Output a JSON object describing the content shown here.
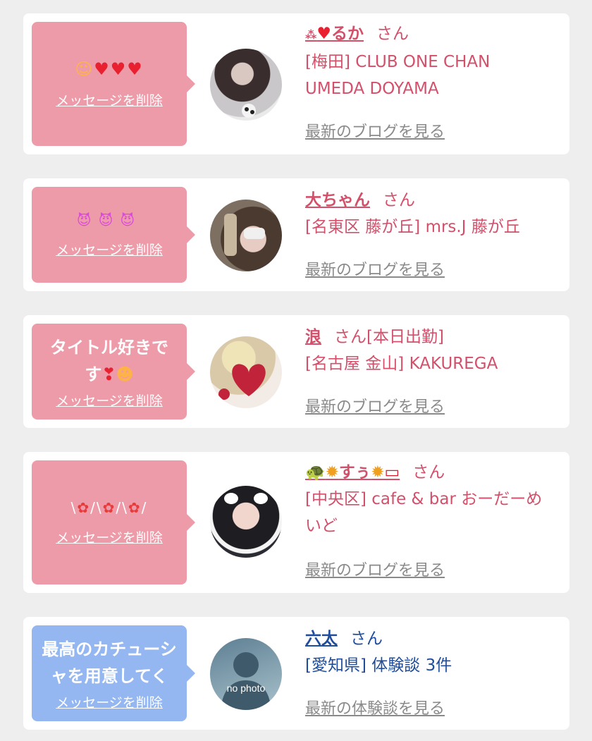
{
  "delete_label": "メッセージを削除",
  "honorific": "さん",
  "items": [
    {
      "message_icons": [
        "smiley-face-icon",
        "heart-icon",
        "heart-icon",
        "heart-icon"
      ],
      "user_name": "るか",
      "name_prefix_icons": [
        "sparkle-icon",
        "heart-icon"
      ],
      "status": "",
      "shop_line1": "[梅田] CLUB ONE CHAN",
      "shop_line2": "UMEDA DOYAMA",
      "link": "最新のブログを見る",
      "bubble_color": "#ee9ba9"
    },
    {
      "message_icons": [
        "smiling-devil-icon",
        "smiling-devil-icon",
        "smiling-devil-icon"
      ],
      "user_name": "大ちゃん",
      "status": "",
      "shop_line1": "[名東区 藤が丘] mrs.J 藤が丘",
      "link": "最新のブログを見る",
      "bubble_color": "#ee9ba9"
    },
    {
      "message_line1": "タイトル好きで",
      "message_line2": "す",
      "message_icons": [
        "heart-exclamation-icon",
        "grinning-squint-face-icon"
      ],
      "user_name": "浪",
      "status": "[本日出勤]",
      "shop_line1": "[名古屋 金山] KAKUREGA",
      "link": "最新のブログを見る",
      "bubble_color": "#ee9ba9"
    },
    {
      "message_icons": [
        "tulip-icon",
        "tulip-icon",
        "tulip-icon"
      ],
      "message_deco": "\\ ✿ /\\ ✿ /\\ ✿ /",
      "user_name": "すぅ",
      "name_icons": [
        "turtle-icon",
        "sunflower-icon",
        "sunflower-icon",
        "mouth-icon"
      ],
      "status": "",
      "shop_line1": "[中央区] cafe & bar おーだーめ",
      "shop_line2": "いど",
      "link": "最新のブログを見る",
      "bubble_color": "#ee9ba9"
    },
    {
      "message_line1": "最高のカチューシ",
      "message_line2": "ャを用意してく",
      "user_name": "六太",
      "status": "",
      "shop_line1": "[愛知県] 体験談 3件",
      "link": "最新の体験談を見る",
      "avatar_text": "no photo",
      "bubble_color": "#94b7f2"
    }
  ],
  "colors": {
    "pink_accent": "#d3506b",
    "blue_accent": "#1f4d9c",
    "pink_bubble": "#ee9ba9",
    "blue_bubble": "#94b7f2",
    "link_gray": "#8a8a8a"
  }
}
